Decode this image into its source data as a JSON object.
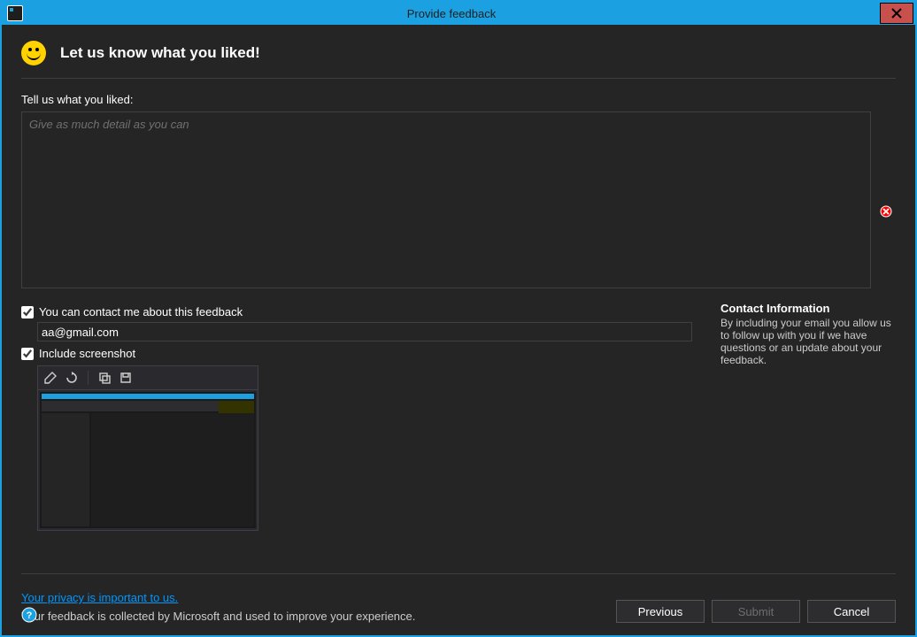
{
  "window": {
    "title": "Provide feedback"
  },
  "header": {
    "heading": "Let us know what you liked!"
  },
  "form": {
    "tell_us_label": "Tell us what you liked:",
    "placeholder": "Give as much detail as you can",
    "text": "",
    "contact_label": "You can contact me about this feedback",
    "contact_checked": true,
    "email": "aa@gmail.com",
    "screenshot_label": "Include screenshot",
    "screenshot_checked": true
  },
  "contact_info": {
    "title": "Contact Information",
    "body": "By including your email you allow us to follow up with you if we have questions or an update about your feedback."
  },
  "privacy": {
    "link": "Your privacy is important to us.",
    "text": "Your feedback is collected by Microsoft and used to improve your experience."
  },
  "buttons": {
    "previous": "Previous",
    "submit": "Submit",
    "cancel": "Cancel"
  }
}
